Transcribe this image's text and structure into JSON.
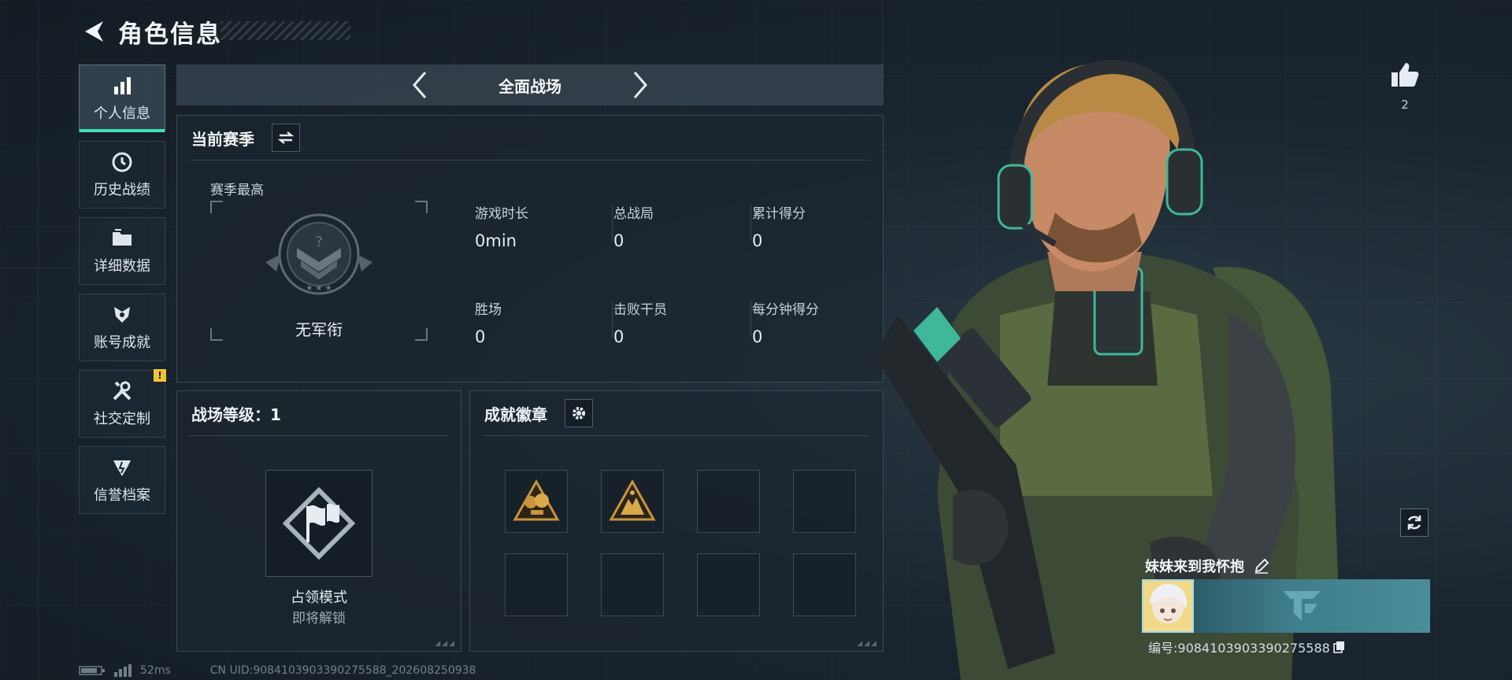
{
  "header": {
    "title": "角色信息"
  },
  "sidebar": {
    "items": [
      {
        "label": "个人信息",
        "icon": "bar-chart-icon",
        "active": true
      },
      {
        "label": "历史战绩",
        "icon": "history-icon"
      },
      {
        "label": "详细数据",
        "icon": "folder-icon"
      },
      {
        "label": "账号成就",
        "icon": "achievement-icon"
      },
      {
        "label": "社交定制",
        "icon": "tools-icon",
        "badge": "!"
      },
      {
        "label": "信誉档案",
        "icon": "reputation-icon"
      }
    ]
  },
  "mode_bar": {
    "title": "全面战场"
  },
  "season": {
    "title": "当前赛季",
    "best_label": "赛季最高",
    "rank_name": "无军衔",
    "stats": [
      {
        "label": "游戏时长",
        "value": "0min"
      },
      {
        "label": "总战局",
        "value": "0"
      },
      {
        "label": "累计得分",
        "value": "0"
      },
      {
        "label": "胜场",
        "value": "0"
      },
      {
        "label": "击败干员",
        "value": "0"
      },
      {
        "label": "每分钟得分",
        "value": "0"
      }
    ]
  },
  "level": {
    "title": "战场等级：1",
    "mode_name": "占领模式",
    "mode_status": "即将解锁"
  },
  "badges": {
    "title": "成就徽章",
    "slots_total": 8,
    "filled": 2
  },
  "likes": {
    "count": "2"
  },
  "player": {
    "name": "妹妹来到我怀抱",
    "id_label": "编号:9084103903390275588"
  },
  "status": {
    "ping": "52ms",
    "uid": "CN UID:9084103903390275588_202608250938"
  },
  "colors": {
    "accent": "#3fe2b4",
    "badge_yellow": "#f2c23a",
    "gold": "#c8953a"
  }
}
